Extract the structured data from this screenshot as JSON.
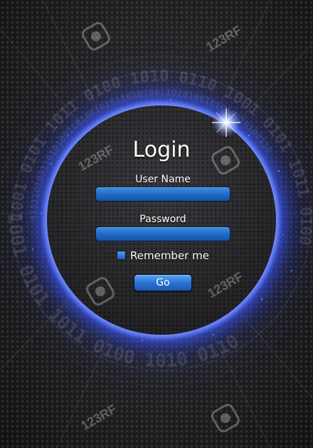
{
  "login": {
    "title": "Login",
    "username_label": "User Name",
    "username_value": "",
    "password_label": "Password",
    "password_value": "",
    "remember_label": "Remember me",
    "remember_checked": false,
    "go_label": "Go"
  },
  "watermark": {
    "text": "123RF"
  },
  "colors": {
    "accent_glow": "#3c5aff",
    "field_blue": "#1f68c4",
    "background": "#1b1b1d"
  },
  "icons": [
    "watermark-logo-icon",
    "lens-flare-icon"
  ]
}
